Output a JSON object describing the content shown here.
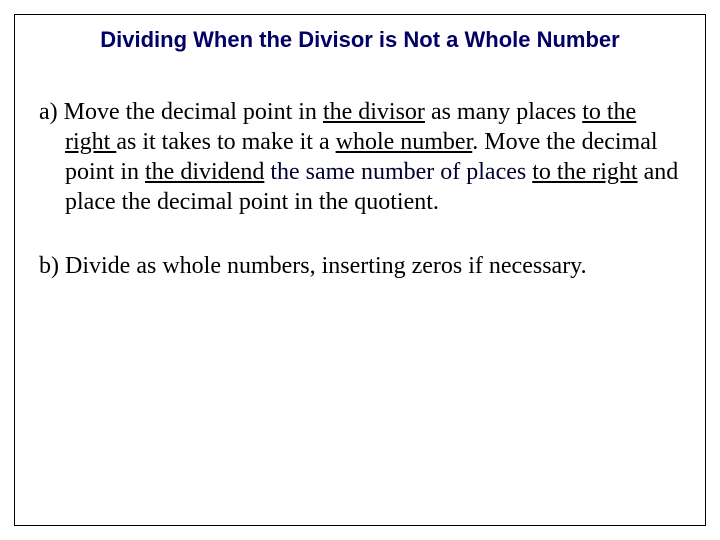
{
  "title": "Dividing When the Divisor is Not a Whole Number",
  "a": {
    "label": "a)",
    "p1_before_u1": " Move the decimal point in ",
    "u1": "the divisor",
    "p1_between_u1_u2": " as many places ",
    "u2": "to the right ",
    "p1_between_u2_u3": "as it takes to make it a ",
    "u3": "whole number",
    "p2_before_u4": ". Move the decimal point in ",
    "u4": "the dividend",
    "p2_between_u4_u5": " the same number of places ",
    "u5": "to the right",
    "p2_after_u5": " and place the decimal point in the quotient."
  },
  "b": {
    "label": "b)",
    "text": " Divide as whole numbers, inserting zeros if necessary."
  }
}
